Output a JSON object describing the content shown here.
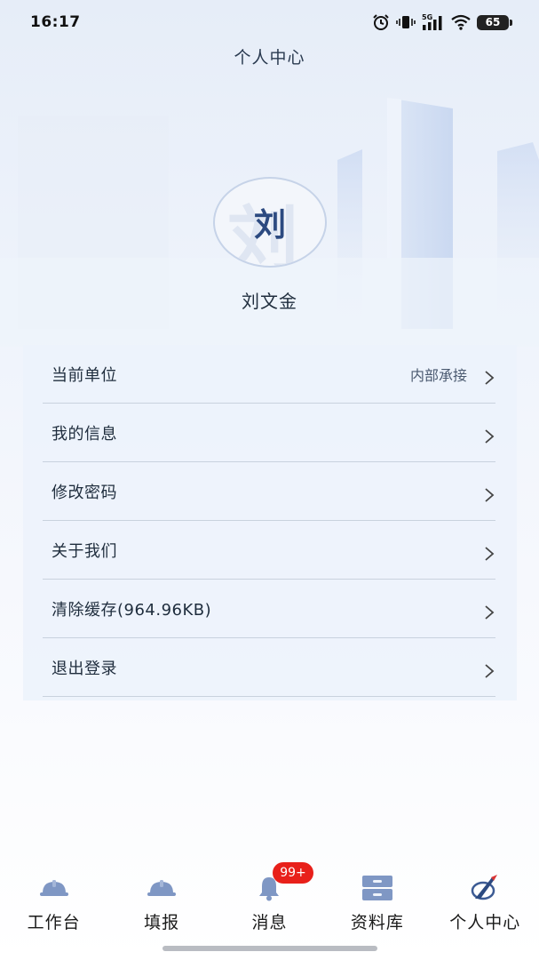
{
  "status_bar": {
    "time": "16:17",
    "network": "5G",
    "battery": "65",
    "icons": [
      "alarm-icon",
      "vibrate-icon",
      "signal-icon",
      "wifi-icon",
      "battery-icon"
    ]
  },
  "header": {
    "title": "个人中心"
  },
  "profile": {
    "avatar_text": "刘",
    "name": "刘文金"
  },
  "menu": {
    "items": [
      {
        "label": "当前单位",
        "value": "内部承接"
      },
      {
        "label": "我的信息",
        "value": ""
      },
      {
        "label": "修改密码",
        "value": ""
      },
      {
        "label": "关于我们",
        "value": ""
      },
      {
        "label": "清除缓存(964.96KB)",
        "value": ""
      },
      {
        "label": "退出登录",
        "value": ""
      }
    ]
  },
  "tab_bar": {
    "tabs": [
      {
        "label": "工作台",
        "icon": "helmet-icon"
      },
      {
        "label": "填报",
        "icon": "helmet-icon"
      },
      {
        "label": "消息",
        "icon": "bell-icon",
        "badge": "99+"
      },
      {
        "label": "资料库",
        "icon": "cabinet-icon"
      },
      {
        "label": "个人中心",
        "icon": "profile-logo-icon"
      }
    ]
  },
  "colors": {
    "accent": "#2c4a80",
    "icon_blue": "#7f97c4",
    "badge_red": "#e8201a",
    "menu_bg": "#ecf2fb"
  }
}
